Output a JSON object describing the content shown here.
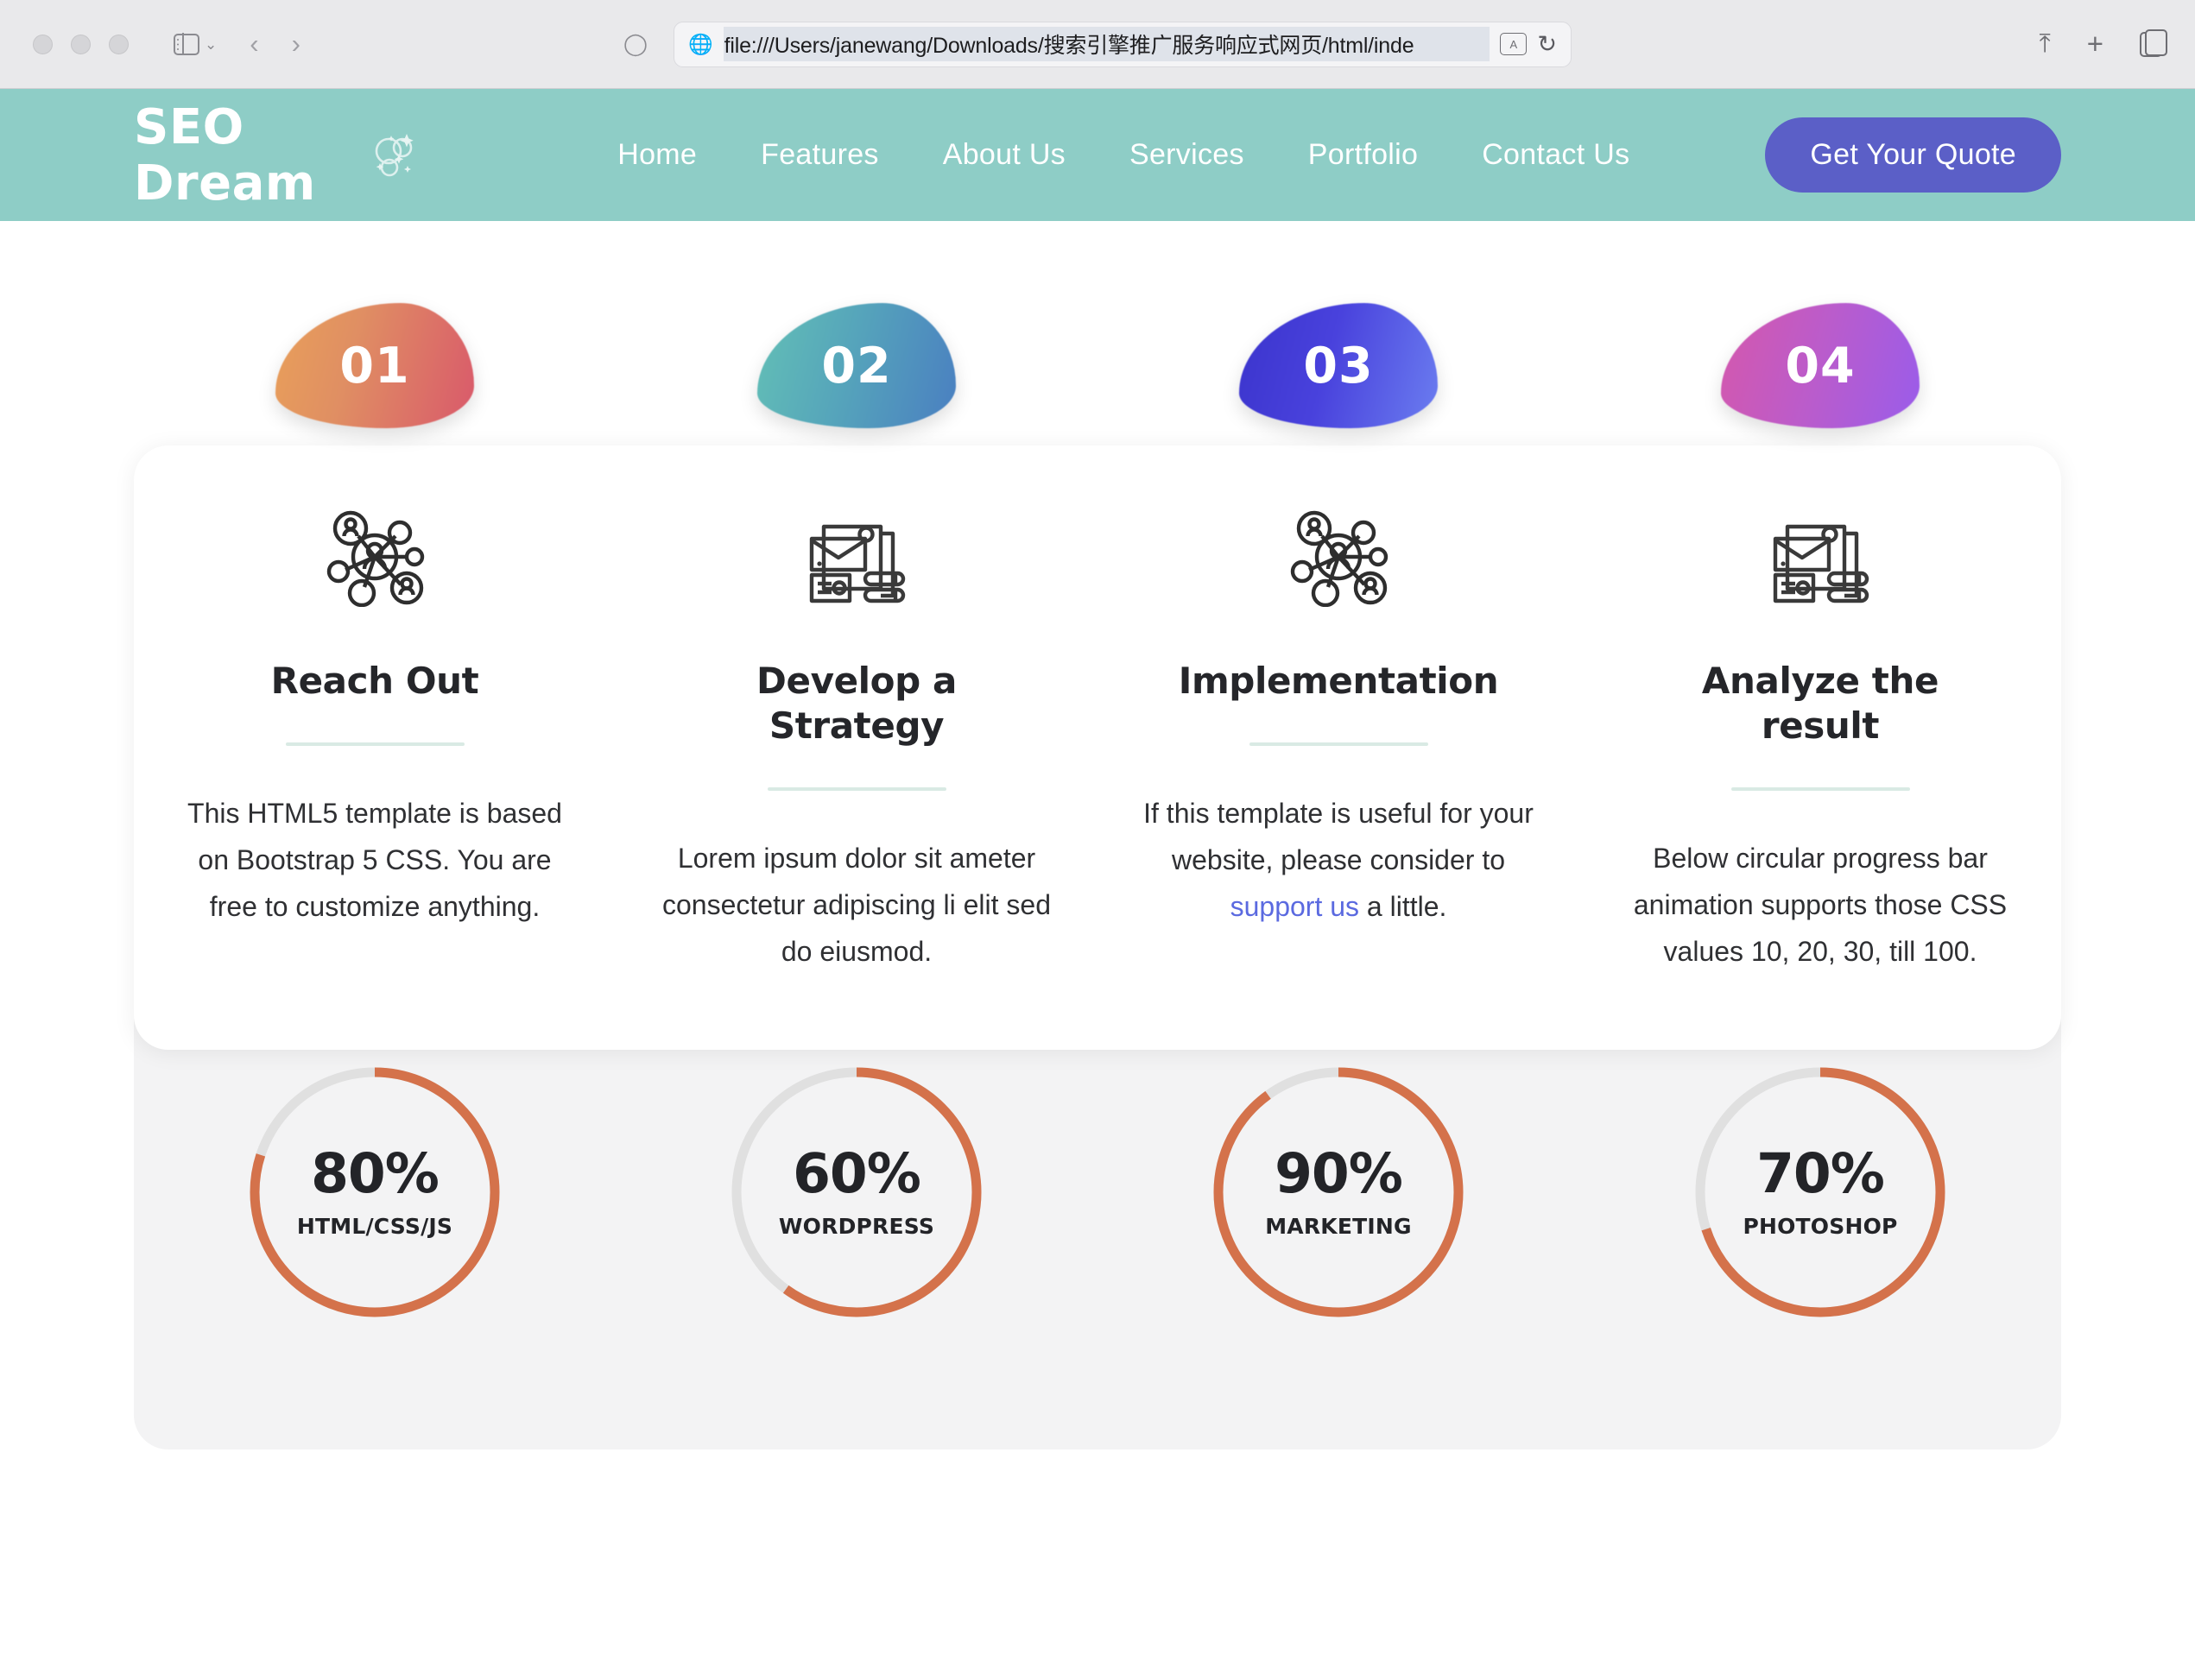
{
  "browser": {
    "url": "file:///Users/janewang/Downloads/搜索引擎推广服务响应式网页/html/inde",
    "globe_icon": "globe-icon",
    "shield_icon": "shield-icon",
    "translate_icon": "translate-icon",
    "reload_icon": "reload-icon",
    "back_arrow": "‹",
    "forward_arrow": "›",
    "sidebar_chevron": "⌄",
    "share_icon": "⇧",
    "new_tab_icon": "+",
    "tab_overview_icon": "tabs-icon"
  },
  "navbar": {
    "brand": "SEO Dream",
    "brand_icon": "bubbles-sparkle-icon",
    "background_color": "#8ecdc6",
    "links": [
      {
        "label": "Home"
      },
      {
        "label": "Features"
      },
      {
        "label": "About Us"
      },
      {
        "label": "Services"
      },
      {
        "label": "Portfolio"
      },
      {
        "label": "Contact Us"
      }
    ],
    "cta": {
      "label": "Get Your Quote",
      "color": "#5b5fc7"
    }
  },
  "steps": [
    {
      "number": "01",
      "title": "Reach Out",
      "text_before": "This HTML5 template is based on Bootstrap 5 CSS. You are free to customize anything.",
      "link_text": "",
      "text_after": "",
      "icon": "network-people-icon",
      "blob_from": "#e9a05a",
      "blob_to": "#d9596b"
    },
    {
      "number": "02",
      "title": "Develop a Strategy",
      "text_before": "Lorem ipsum dolor sit ameter consectetur adipiscing li elit sed do eiusmod.",
      "link_text": "",
      "text_after": "",
      "icon": "stationery-branding-icon",
      "blob_from": "#63c0b6",
      "blob_to": "#4a7fc1"
    },
    {
      "number": "03",
      "title": "Implementation",
      "text_before": "If this template is useful for your website, please consider to ",
      "link_text": "support us",
      "text_after": " a little.",
      "icon": "network-people-icon",
      "blob_from": "#3b34cc",
      "blob_to": "#6b7df0"
    },
    {
      "number": "04",
      "title": "Analyze the result",
      "text_before": "Below circular progress bar animation supports those CSS values 10, 20, 30, till 100.",
      "link_text": "",
      "text_after": "",
      "icon": "stationery-branding-icon",
      "blob_from": "#d558ac",
      "blob_to": "#9a5cea"
    }
  ],
  "chart_data": {
    "type": "pie",
    "title": "",
    "subtitle": "Circular progress bars (skills)",
    "categories": [
      "HTML/CSS/JS",
      "WORDPRESS",
      "MARKETING",
      "PHOTOSHOP"
    ],
    "values": [
      80,
      60,
      90,
      70
    ],
    "unit": "%",
    "ylim": [
      0,
      100
    ],
    "track_color": "#e0e0e0",
    "bar_color": "#d4724b",
    "legend": false,
    "grid": false
  },
  "progress": [
    {
      "value": "80%",
      "percent": 80,
      "label": "HTML/CSS/JS"
    },
    {
      "value": "60%",
      "percent": 60,
      "label": "WORDPRESS"
    },
    {
      "value": "90%",
      "percent": 90,
      "label": "MARKETING"
    },
    {
      "value": "70%",
      "percent": 70,
      "label": "PHOTOSHOP"
    }
  ],
  "colors": {
    "brand_teal": "#8ecdc6",
    "cta_indigo": "#5b5fc7",
    "progress_orange": "#d4724b",
    "progress_track": "#e0e0e0",
    "rule_mint": "#d9eae4",
    "link_blue": "#5b6ae0"
  }
}
